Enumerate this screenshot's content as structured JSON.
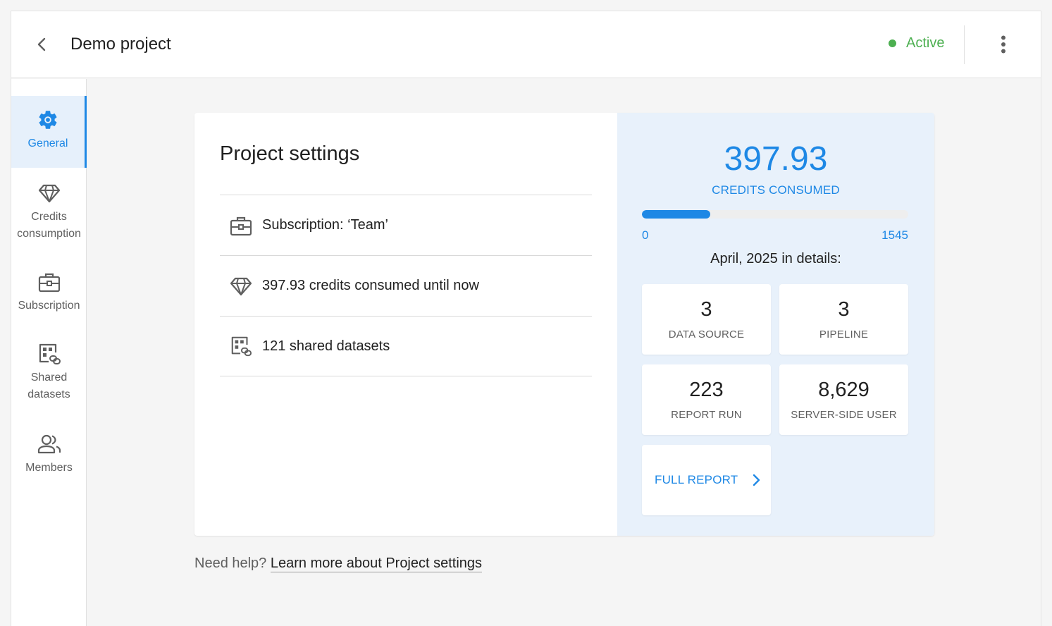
{
  "header": {
    "title": "Demo project",
    "status": "Active",
    "status_color": "#4caf50"
  },
  "sidebar": {
    "items": [
      {
        "label": "General",
        "icon": "gear-icon",
        "active": true
      },
      {
        "label": "Credits consumption",
        "icon": "diamond-icon",
        "active": false
      },
      {
        "label": "Subscription",
        "icon": "briefcase-icon",
        "active": false
      },
      {
        "label": "Shared datasets",
        "icon": "shared-dataset-icon",
        "active": false
      },
      {
        "label": "Members",
        "icon": "members-icon",
        "active": false
      }
    ]
  },
  "settings": {
    "title": "Project settings",
    "rows": [
      {
        "icon": "briefcase-icon",
        "text": "Subscription: ‘Team’"
      },
      {
        "icon": "diamond-icon",
        "text": "397.93 credits consumed until now"
      },
      {
        "icon": "shared-dataset-icon",
        "text": "121 shared datasets"
      }
    ]
  },
  "credits": {
    "value": "397.93",
    "label": "CREDITS CONSUMED",
    "min": "0",
    "max": "1545",
    "progress_fraction": 0.2576,
    "details_title": "April, 2025 in details:",
    "stats": [
      {
        "value": "3",
        "label": "DATA SOURCE"
      },
      {
        "value": "3",
        "label": "PIPELINE"
      },
      {
        "value": "223",
        "label": "REPORT RUN"
      },
      {
        "value": "8,629",
        "label": "SERVER-SIDE USER"
      }
    ],
    "full_report_label": "FULL REPORT"
  },
  "help": {
    "prefix": "Need help?",
    "link": "Learn more about Project settings"
  },
  "colors": {
    "accent": "#1e88e5",
    "accent_bg": "#e8f1fb",
    "active_nav_bg": "#e6f0fb"
  }
}
